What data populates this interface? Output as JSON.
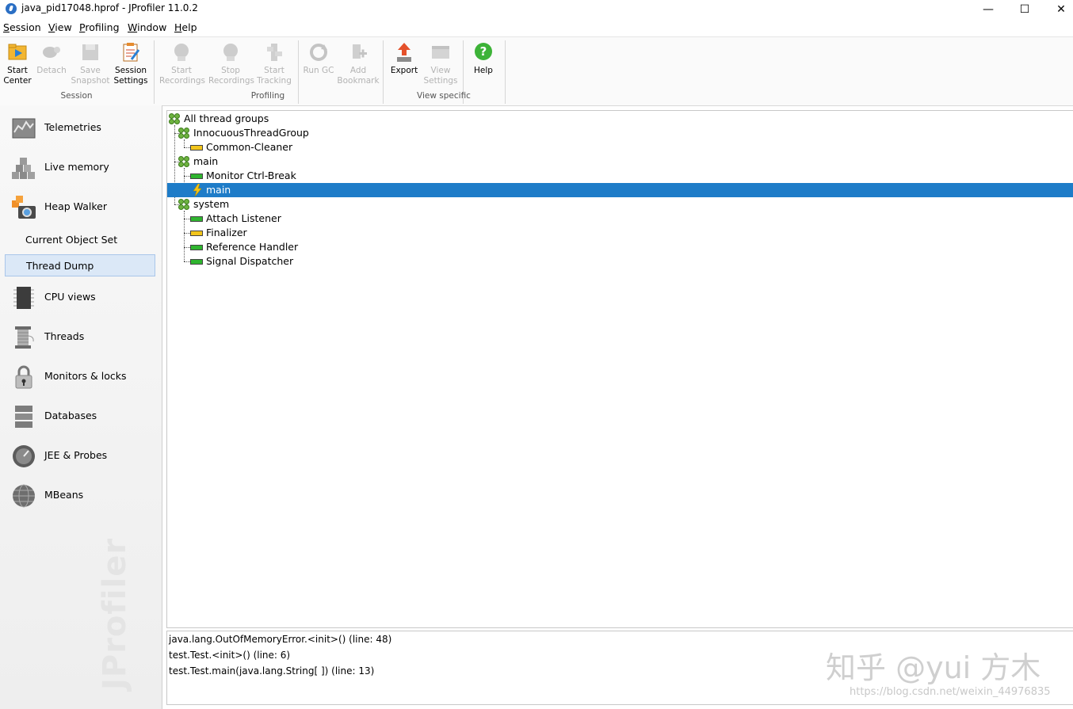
{
  "window": {
    "title": "java_pid17048.hprof - JProfiler 11.0.2",
    "minimize": "—",
    "maximize": "☐",
    "close": "✕"
  },
  "menu": [
    {
      "label": "Session",
      "mnemonic": "S",
      "rest": "ession"
    },
    {
      "label": "View",
      "mnemonic": "V",
      "rest": "iew"
    },
    {
      "label": "Profiling",
      "mnemonic": "P",
      "rest": "rofiling"
    },
    {
      "label": "Window",
      "mnemonic": "W",
      "rest": "indow"
    },
    {
      "label": "Help",
      "mnemonic": "H",
      "rest": "elp"
    }
  ],
  "toolbar": {
    "buttons": [
      {
        "line1": "Start",
        "line2": "Center",
        "icon": "start-center-icon",
        "enabled": true
      },
      {
        "line1": "Detach",
        "line2": "",
        "icon": "detach-icon",
        "enabled": false
      },
      {
        "line1": "Save",
        "line2": "Snapshot",
        "icon": "save-snapshot-icon",
        "enabled": false
      },
      {
        "line1": "Session",
        "line2": "Settings",
        "icon": "session-settings-icon",
        "enabled": true
      },
      {
        "line1": "Start",
        "line2": "Recordings",
        "icon": "start-recordings-icon",
        "enabled": false
      },
      {
        "line1": "Stop",
        "line2": "Recordings",
        "icon": "stop-recordings-icon",
        "enabled": false
      },
      {
        "line1": "Start",
        "line2": "Tracking",
        "icon": "start-tracking-icon",
        "enabled": false
      },
      {
        "line1": "Run GC",
        "line2": "",
        "icon": "run-gc-icon",
        "enabled": false
      },
      {
        "line1": "Add",
        "line2": "Bookmark",
        "icon": "add-bookmark-icon",
        "enabled": false
      },
      {
        "line1": "Export",
        "line2": "",
        "icon": "export-icon",
        "enabled": true
      },
      {
        "line1": "View",
        "line2": "Settings",
        "icon": "view-settings-icon",
        "enabled": false
      },
      {
        "line1": "Help",
        "line2": "",
        "icon": "help-icon",
        "enabled": true
      }
    ],
    "groups": [
      "Session",
      "Profiling",
      "View specific"
    ]
  },
  "sidebar": {
    "items": [
      {
        "label": "Telemetries",
        "icon": "telemetries-icon"
      },
      {
        "label": "Live memory",
        "icon": "live-memory-icon"
      },
      {
        "label": "Heap Walker",
        "icon": "heap-walker-icon"
      },
      {
        "label": "Current Object Set",
        "sub": true
      },
      {
        "label": "Thread Dump",
        "sub": true,
        "selected": true
      },
      {
        "label": "CPU views",
        "icon": "cpu-views-icon"
      },
      {
        "label": "Threads",
        "icon": "threads-icon"
      },
      {
        "label": "Monitors & locks",
        "icon": "monitors-locks-icon"
      },
      {
        "label": "Databases",
        "icon": "databases-icon"
      },
      {
        "label": "JEE & Probes",
        "icon": "jee-probes-icon"
      },
      {
        "label": "MBeans",
        "icon": "mbeans-icon"
      }
    ],
    "brand": "JProfiler"
  },
  "tree": {
    "nodes": [
      {
        "label": "All thread groups",
        "kind": "group",
        "depth": 0
      },
      {
        "label": "InnocuousThreadGroup",
        "kind": "group",
        "depth": 1
      },
      {
        "label": "Common-Cleaner",
        "kind": "thread",
        "state": "waiting",
        "depth": 2
      },
      {
        "label": "main",
        "kind": "group",
        "depth": 1
      },
      {
        "label": "Monitor Ctrl-Break",
        "kind": "thread",
        "state": "runnable",
        "depth": 2
      },
      {
        "label": "main",
        "kind": "thread",
        "state": "current",
        "depth": 2,
        "selected": true
      },
      {
        "label": "system",
        "kind": "group",
        "depth": 1
      },
      {
        "label": "Attach Listener",
        "kind": "thread",
        "state": "runnable",
        "depth": 2
      },
      {
        "label": "Finalizer",
        "kind": "thread",
        "state": "waiting",
        "depth": 2
      },
      {
        "label": "Reference Handler",
        "kind": "thread",
        "state": "runnable",
        "depth": 2
      },
      {
        "label": "Signal Dispatcher",
        "kind": "thread",
        "state": "runnable",
        "depth": 2
      }
    ],
    "colors": {
      "selection": "#1e7cc8",
      "runnable": "#2fb52f",
      "waiting": "#f2c51c"
    }
  },
  "stack": {
    "frames": [
      "java.lang.OutOfMemoryError.<init>() (line: 48)",
      "test.Test.<init>() (line: 6)",
      "test.Test.main(java.lang.String[ ]) (line: 13)"
    ]
  },
  "watermark": {
    "text": "知乎 @yui 方木",
    "url": "https://blog.csdn.net/weixin_44976835"
  }
}
